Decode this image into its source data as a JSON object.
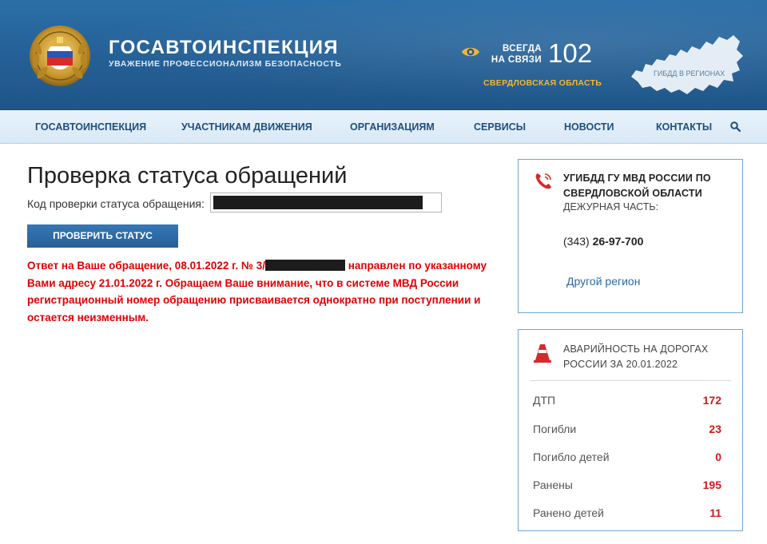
{
  "header": {
    "title": "ГОСАВТОИНСПЕКЦИЯ",
    "subtitle": "УВАЖЕНИЕ ПРОФЕССИОНАЛИЗМ БЕЗОПАСНОСТЬ",
    "always_line1": "ВСЕГДА",
    "always_line2": "НА СВЯЗИ",
    "phone": "102",
    "region": "СВЕРДЛОВСКАЯ ОБЛАСТЬ",
    "map_label": "ГИБДД В РЕГИОНАХ",
    "colors": {
      "bar": "#245f95",
      "region": "#f2b632"
    },
    "icons": [
      "emblem-icon",
      "eye-icon",
      "russia-map-icon"
    ]
  },
  "nav": {
    "items": [
      "ГОСАВТОИНСПЕКЦИЯ",
      "УЧАСТНИКАМ ДВИЖЕНИЯ",
      "ОРГАНИЗАЦИЯМ",
      "СЕРВИСЫ",
      "НОВОСТИ",
      "КОНТАКТЫ"
    ],
    "search_icon": "search-icon"
  },
  "main": {
    "title": "Проверка статуса обращений",
    "field_label": "Код проверки статуса обращения:",
    "field_value": "",
    "button_label": "ПРОВЕРИТЬ СТАТУС",
    "result_part1": "Ответ на Ваше обращение, 08.01.2022 г. № 3/",
    "result_part2": " направлен по указанному Вами адресу 21.01.2022 г. Обращаем Ваше внимание, что в системе МВД России регистрационный номер обращению присваивается однократно при поступлении и остается неизменным.",
    "result_color": "#e00000"
  },
  "contact_box": {
    "icon": "phone-icon",
    "dept_line1": "УГИБДД ГУ МВД РОССИИ ПО",
    "dept_line2": "СВЕРДЛОВСКОЙ ОБЛАСТИ",
    "duty_label": "ДЕЖУРНАЯ ЧАСТЬ:",
    "phone_code": "(343)",
    "phone_number": "26-97-700",
    "other_region": "Другой регион"
  },
  "accidents_box": {
    "icon": "traffic-cone-icon",
    "title_line1": "АВАРИЙНОСТЬ НА ДОРОГАХ",
    "title_line2": "РОССИИ ЗА 20.01.2022",
    "stats": [
      {
        "label": "ДТП",
        "value": "172"
      },
      {
        "label": "Погибли",
        "value": "23"
      },
      {
        "label": "Погибло детей",
        "value": "0"
      },
      {
        "label": "Ранены",
        "value": "195"
      },
      {
        "label": "Ранено детей",
        "value": "11"
      }
    ],
    "value_color": "#d11a1a"
  }
}
